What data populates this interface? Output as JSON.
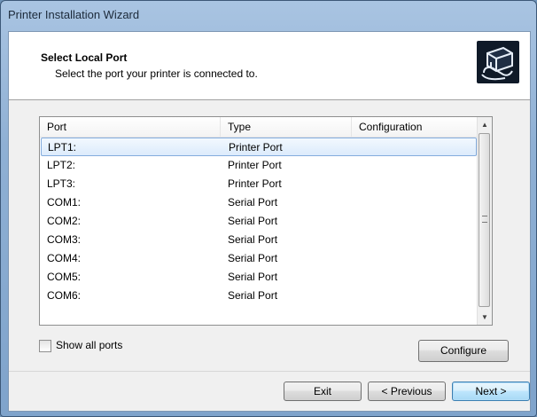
{
  "window": {
    "title": "Printer Installation Wizard"
  },
  "header": {
    "title": "Select Local Port",
    "subtitle": "Select the port your printer is connected to.",
    "icon": "printer-icon"
  },
  "table": {
    "columns": [
      "Port",
      "Type",
      "Configuration"
    ],
    "rows": [
      {
        "port": "LPT1:",
        "type": "Printer Port",
        "configuration": "",
        "selected": true
      },
      {
        "port": "LPT2:",
        "type": "Printer Port",
        "configuration": ""
      },
      {
        "port": "LPT3:",
        "type": "Printer Port",
        "configuration": ""
      },
      {
        "port": "COM1:",
        "type": "Serial Port",
        "configuration": ""
      },
      {
        "port": "COM2:",
        "type": "Serial Port",
        "configuration": ""
      },
      {
        "port": "COM3:",
        "type": "Serial Port",
        "configuration": ""
      },
      {
        "port": "COM4:",
        "type": "Serial Port",
        "configuration": ""
      },
      {
        "port": "COM5:",
        "type": "Serial Port",
        "configuration": ""
      },
      {
        "port": "COM6:",
        "type": "Serial Port",
        "configuration": ""
      }
    ]
  },
  "options": {
    "show_all_ports_label": "Show all ports",
    "show_all_ports_checked": false
  },
  "buttons": {
    "configure": "Configure",
    "exit": "Exit",
    "previous": "< Previous",
    "next": "Next >"
  }
}
